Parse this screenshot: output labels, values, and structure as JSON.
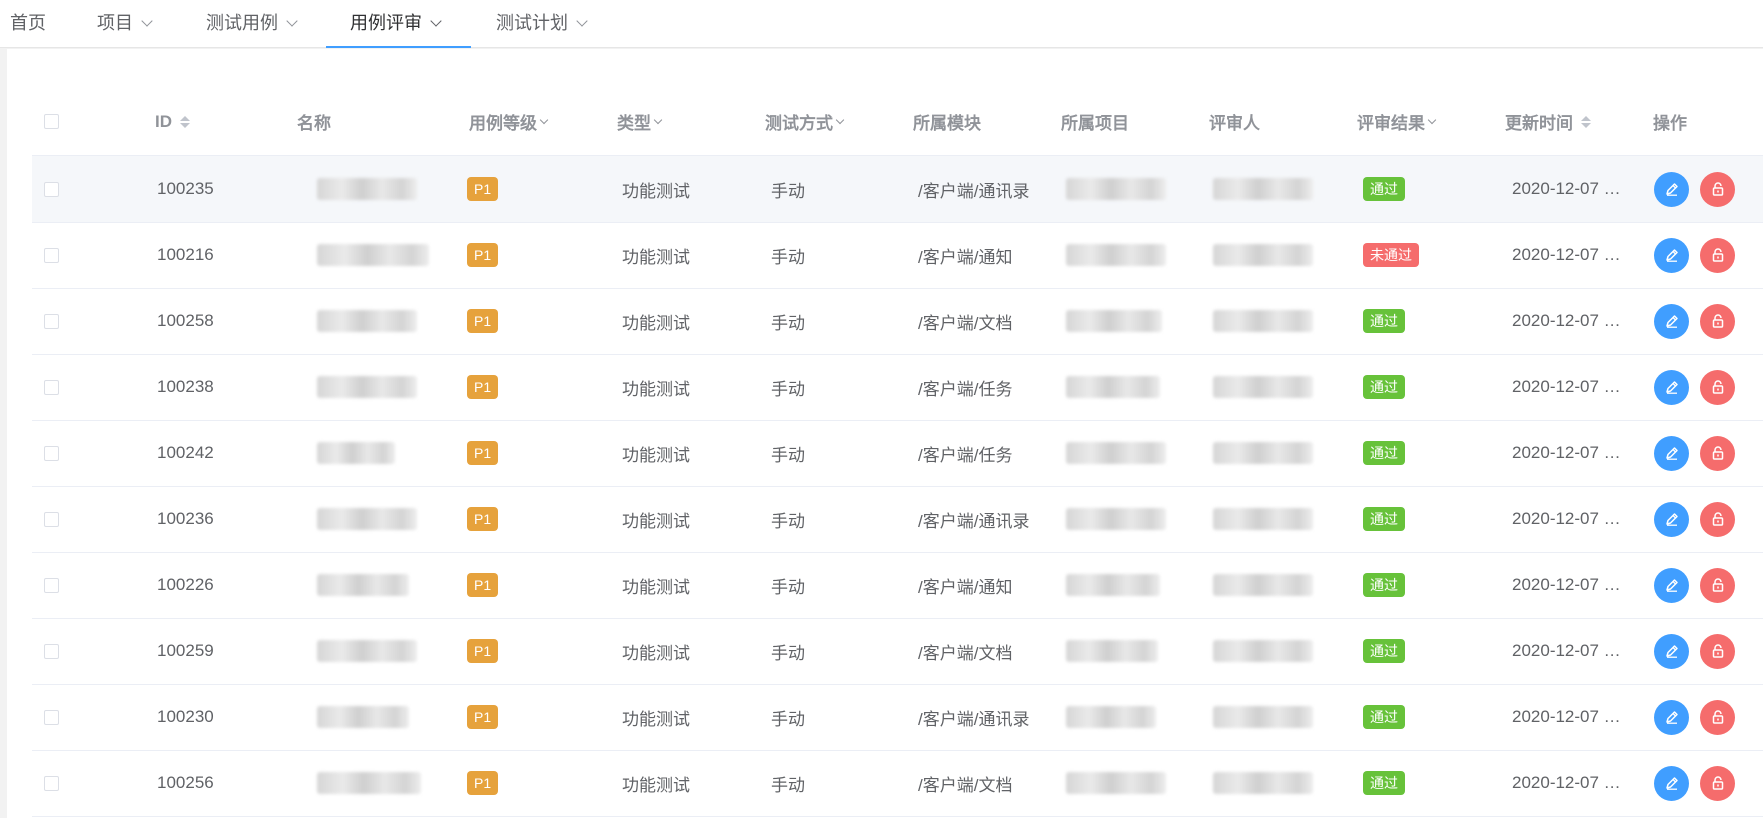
{
  "nav": {
    "items": [
      {
        "label": "首页",
        "dropdown": false,
        "active": false
      },
      {
        "label": "项目",
        "dropdown": true,
        "active": false
      },
      {
        "label": "测试用例",
        "dropdown": true,
        "active": false
      },
      {
        "label": "用例评审",
        "dropdown": true,
        "active": true
      },
      {
        "label": "测试计划",
        "dropdown": true,
        "active": false
      }
    ]
  },
  "table": {
    "headers": {
      "id": "ID",
      "name": "名称",
      "level": "用例等级",
      "type": "类型",
      "method": "测试方式",
      "module": "所属模块",
      "project": "所属项目",
      "reviewer": "评审人",
      "result": "评审结果",
      "updated": "更新时间",
      "actions": "操作"
    },
    "rows": [
      {
        "id": "100235",
        "level": "P1",
        "type": "功能测试",
        "method": "手动",
        "module": "/客户端/通讯录",
        "result": "通过",
        "updated": "2020-12-07 …"
      },
      {
        "id": "100216",
        "level": "P1",
        "type": "功能测试",
        "method": "手动",
        "module": "/客户端/通知",
        "result": "未通过",
        "updated": "2020-12-07 …"
      },
      {
        "id": "100258",
        "level": "P1",
        "type": "功能测试",
        "method": "手动",
        "module": "/客户端/文档",
        "result": "通过",
        "updated": "2020-12-07 …"
      },
      {
        "id": "100238",
        "level": "P1",
        "type": "功能测试",
        "method": "手动",
        "module": "/客户端/任务",
        "result": "通过",
        "updated": "2020-12-07 …"
      },
      {
        "id": "100242",
        "level": "P1",
        "type": "功能测试",
        "method": "手动",
        "module": "/客户端/任务",
        "result": "通过",
        "updated": "2020-12-07 …"
      },
      {
        "id": "100236",
        "level": "P1",
        "type": "功能测试",
        "method": "手动",
        "module": "/客户端/通讯录",
        "result": "通过",
        "updated": "2020-12-07 …"
      },
      {
        "id": "100226",
        "level": "P1",
        "type": "功能测试",
        "method": "手动",
        "module": "/客户端/通知",
        "result": "通过",
        "updated": "2020-12-07 …"
      },
      {
        "id": "100259",
        "level": "P1",
        "type": "功能测试",
        "method": "手动",
        "module": "/客户端/文档",
        "result": "通过",
        "updated": "2020-12-07 …"
      },
      {
        "id": "100230",
        "level": "P1",
        "type": "功能测试",
        "method": "手动",
        "module": "/客户端/通讯录",
        "result": "通过",
        "updated": "2020-12-07 …"
      },
      {
        "id": "100256",
        "level": "P1",
        "type": "功能测试",
        "method": "手动",
        "module": "/客户端/文档",
        "result": "通过",
        "updated": "2020-12-07 …"
      }
    ]
  },
  "icons": {
    "edit": "pencil-icon",
    "delete": "unlock-icon",
    "sort": "sort-caret-icon",
    "filter": "filter-arrow-icon",
    "dropdown": "chevron-down-icon"
  },
  "colors": {
    "accent": "#409eff",
    "pass": "#67c23a",
    "fail": "#f56c6c",
    "level": "#e6a23c"
  }
}
